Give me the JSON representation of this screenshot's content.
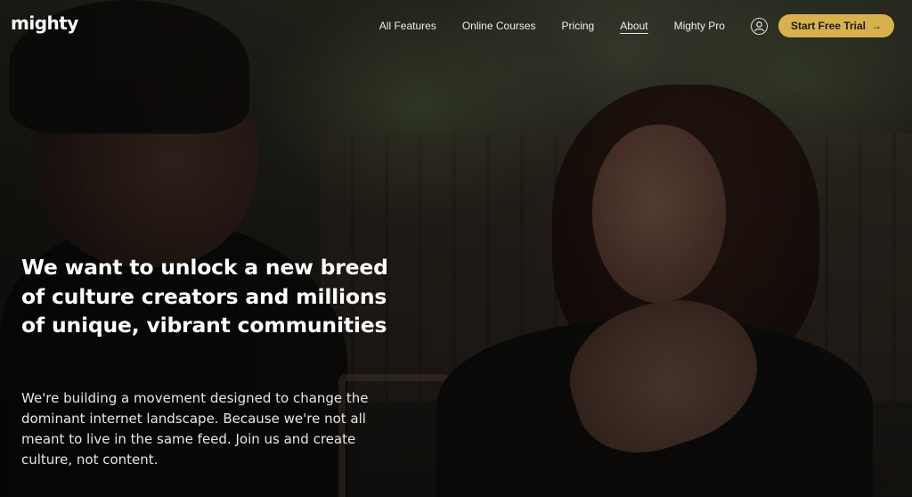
{
  "brand": {
    "logo_text": "mighty"
  },
  "nav": {
    "links": [
      {
        "label": "All Features",
        "active": false
      },
      {
        "label": "Online Courses",
        "active": false
      },
      {
        "label": "Pricing",
        "active": false
      },
      {
        "label": "About",
        "active": true
      },
      {
        "label": "Mighty Pro",
        "active": false
      }
    ],
    "account_icon": "user-circle-icon",
    "cta": {
      "label": "Start Free Trial",
      "arrow": "→"
    }
  },
  "hero": {
    "heading": "We want to unlock a new breed of culture creators and millions of unique, vibrant communities",
    "paragraph": "We're building a movement designed to change the dominant internet landscape. Because we're not all meant to live in the same feed. Join us and create culture, not content."
  },
  "colors": {
    "accent": "#d7b24c",
    "text": "#ffffff"
  }
}
